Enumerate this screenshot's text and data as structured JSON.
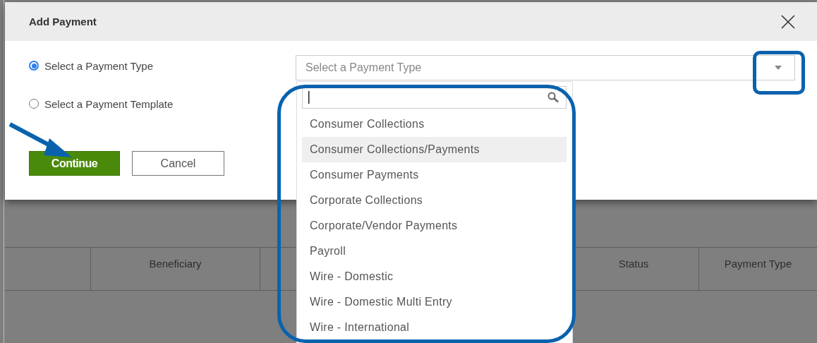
{
  "dialog": {
    "title": "Add Payment",
    "options": [
      {
        "label": "Select a Payment Type",
        "selected": true
      },
      {
        "label": "Select a Payment Template",
        "selected": false
      }
    ],
    "payment_type_select": {
      "placeholder": "Select a Payment Type",
      "expanded": true
    },
    "dropdown": {
      "items": [
        {
          "label": "Consumer Collections",
          "selected": false
        },
        {
          "label": "Consumer Collections/Payments",
          "selected": true
        },
        {
          "label": "Consumer Payments",
          "selected": false
        },
        {
          "label": "Corporate Collections",
          "selected": false
        },
        {
          "label": "Corporate/Vendor Payments",
          "selected": false
        },
        {
          "label": "Payroll",
          "selected": false
        },
        {
          "label": "Wire - Domestic",
          "selected": false
        },
        {
          "label": "Wire - Domestic Multi Entry",
          "selected": false
        },
        {
          "label": "Wire - International",
          "selected": false
        }
      ]
    },
    "buttons": [
      {
        "label": "Continue",
        "kind": "primary"
      },
      {
        "label": "Cancel",
        "kind": "secondary"
      }
    ]
  },
  "table": {
    "header_cells": [
      {},
      {
        "label": "Beneficiary"
      },
      {},
      {
        "label": "Status"
      },
      {
        "label": "Payment Type"
      }
    ]
  }
}
